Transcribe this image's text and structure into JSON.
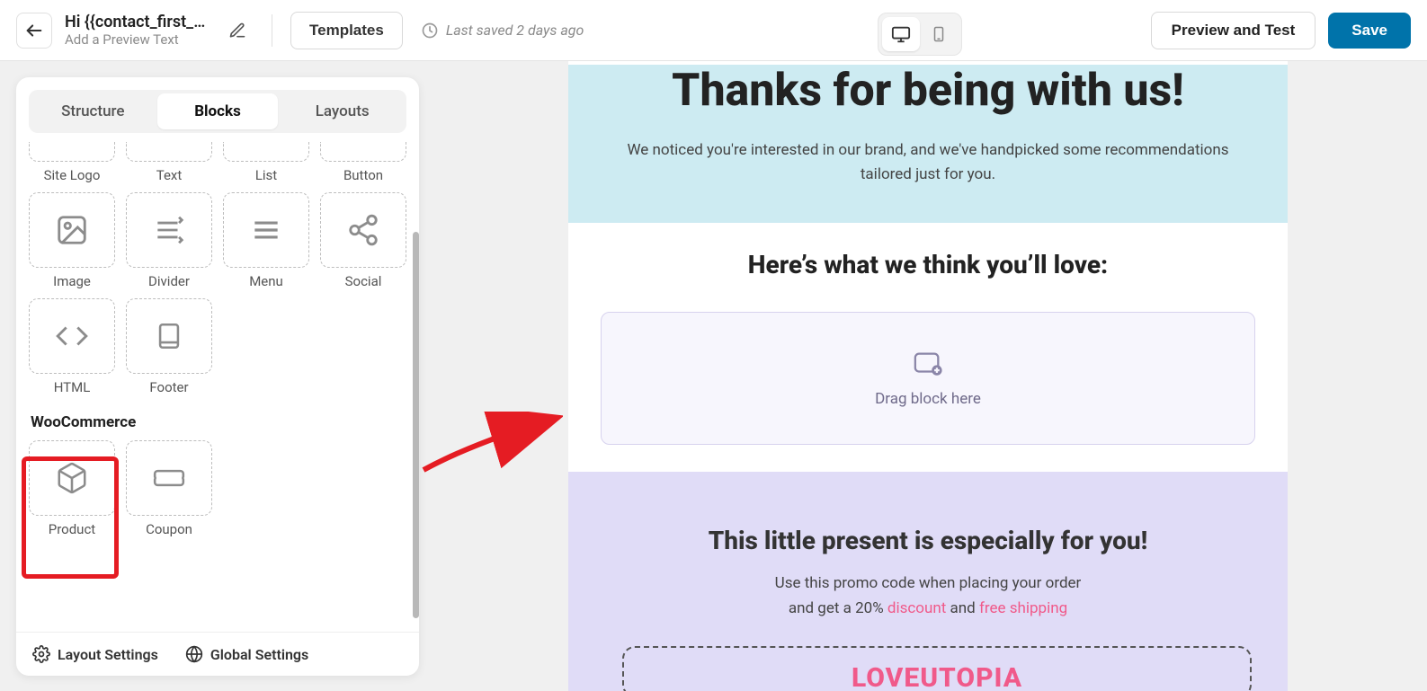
{
  "header": {
    "title": "Hi {{contact_first_n…",
    "subtitle": "Add a Preview Text",
    "templates_label": "Templates",
    "last_saved": "Last saved 2 days ago",
    "preview_label": "Preview and Test",
    "save_label": "Save"
  },
  "sidebar": {
    "tabs": {
      "structure": "Structure",
      "blocks": "Blocks",
      "layouts": "Layouts"
    },
    "partial_row": [
      "Site Logo",
      "Text",
      "List",
      "Button"
    ],
    "row1": [
      "Image",
      "Divider",
      "Menu",
      "Social"
    ],
    "row2": [
      "HTML",
      "Footer"
    ],
    "woocommerce_title": "WooCommerce",
    "row3": [
      "Product",
      "Coupon"
    ],
    "footer": {
      "layout": "Layout Settings",
      "global": "Global Settings"
    }
  },
  "canvas": {
    "hero_title": "Thanks for being with us!",
    "hero_text": "We noticed you're interested in our brand, and we've handpicked some recommendations tailored just for you.",
    "love_title": "Here’s what we think you’ll love:",
    "dropzone_text": "Drag block here",
    "present_title": "This little present is especially for you!",
    "present_line1": "Use this promo code when placing your order",
    "present_line2_prefix": "and get a 20% ",
    "present_discount": "discount",
    "present_and": " and ",
    "present_freeship": "free shipping",
    "promo_code": "LOVEUTOPIA"
  }
}
